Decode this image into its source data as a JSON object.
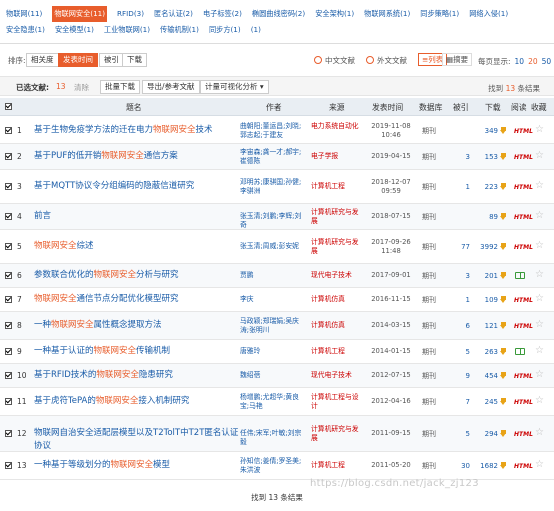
{
  "tags": [
    {
      "label": "物联网",
      "count": "(11)",
      "active": false
    },
    {
      "label": "物联网安全",
      "count": "(11)",
      "active": true
    },
    {
      "label": "RFID",
      "count": "(3)",
      "active": false
    },
    {
      "label": "匿名认证",
      "count": "(2)",
      "active": false
    },
    {
      "label": "电子标签",
      "count": "(2)",
      "active": false
    },
    {
      "label": "椭圆曲线密码",
      "count": "(2)",
      "active": false
    },
    {
      "label": "安全架构",
      "count": "(1)",
      "active": false
    },
    {
      "label": "物联网系统",
      "count": "(1)",
      "active": false
    },
    {
      "label": "同步策略",
      "count": "(1)",
      "active": false
    },
    {
      "label": "网络入侵",
      "count": "(1)",
      "active": false
    },
    {
      "label": "安全隐患",
      "count": "(1)",
      "active": false
    },
    {
      "label": "安全模型",
      "count": "(1)",
      "active": false
    },
    {
      "label": "工业物联网",
      "count": "(1)",
      "active": false
    },
    {
      "label": "传输机制",
      "count": "(1)",
      "active": false
    },
    {
      "label": "同步方",
      "count": "(1)",
      "active": false
    },
    {
      "label": "",
      "count": "(1)",
      "active": false
    }
  ],
  "sort": {
    "label": "排序:",
    "options": [
      "相关度",
      "发表时间",
      "被引",
      "下载"
    ],
    "active_index": 1
  },
  "lang": {
    "chinese": "中文文献",
    "foreign": "外文文献"
  },
  "view": {
    "list": "列表",
    "abstract": "摘要"
  },
  "perpage": {
    "label": "每页显示:",
    "options": [
      "10",
      "20",
      "50"
    ],
    "selected": "20"
  },
  "selection": {
    "label": "已选文献:",
    "count": "13",
    "clear": "清除",
    "buttons": [
      "批量下载",
      "导出/参考文献",
      "计量可视化分析 ▾"
    ]
  },
  "found_top": {
    "prefix": "找到",
    "count": "13",
    "suffix": "条结果"
  },
  "columns": {
    "title": "题名",
    "author": "作者",
    "source": "来源",
    "date": "发表时间",
    "db": "数据库",
    "cite": "被引",
    "download": "下载",
    "read": "阅读",
    "fav": "收藏"
  },
  "rows": [
    {
      "num": "1",
      "title": [
        "基于生物免疫学方法的迁在电力",
        "物联网安全",
        "技术"
      ],
      "author": "曲朝阳;董运昌;刘晓;郭志起;于建友",
      "source": "电力系统自动化",
      "date": "2019-11-08 10:46",
      "db": "期刊",
      "cite": "",
      "download": "349",
      "read": "html"
    },
    {
      "num": "2",
      "title": [
        "基于PUF的低开销",
        "物联网安全",
        "通信方案"
      ],
      "author": "李宙森;龚一才;郝宇;崔德陈",
      "source": "电子学报",
      "date": "2019-04-15",
      "db": "期刊",
      "cite": "3",
      "download": "153",
      "read": "html"
    },
    {
      "num": "3",
      "title": [
        "基于MQTT协议令分组编码的隐蔽信道研究",
        "",
        " "
      ],
      "author": "邓明苏;康骐国;孙健;李骐洲",
      "source": "计算机工程",
      "date": "2018-12-07 09:59",
      "db": "期刊",
      "cite": "1",
      "download": "223",
      "read": "html"
    },
    {
      "num": "4",
      "title": [
        "前言",
        "",
        ""
      ],
      "author": "张玉清;刘鹏;李辉;刘奇",
      "source": "计算机研究与发展",
      "date": "2018-07-15",
      "db": "期刊",
      "cite": "",
      "download": "89",
      "read": "html"
    },
    {
      "num": "5",
      "title": [
        "",
        "物联网安全",
        "综述"
      ],
      "author": "张玉清;周威;彭安妮",
      "source": "计算机研究与发展",
      "date": "2017-09-26 11:48",
      "db": "期刊",
      "cite": "77",
      "download": "3992",
      "read": "html"
    },
    {
      "num": "6",
      "title": [
        "参数联合优化的",
        "物联网安全",
        "分析与研究"
      ],
      "author": "贾鹏",
      "source": "现代电子技术",
      "date": "2017-09-01",
      "db": "期刊",
      "cite": "3",
      "download": "201",
      "read": "book"
    },
    {
      "num": "7",
      "title": [
        "",
        "物联网安全",
        "通信节点分配优化模型研究"
      ],
      "author": "李庆",
      "source": "计算机仿真",
      "date": "2016-11-15",
      "db": "期刊",
      "cite": "1",
      "download": "109",
      "read": "html"
    },
    {
      "num": "8",
      "title": [
        "一种",
        "物联网安全",
        "属性概念提取方法"
      ],
      "author": "马政颖;郑瑞娟;吴庆涛;张明川",
      "source": "计算机仿真",
      "date": "2014-03-15",
      "db": "期刊",
      "cite": "6",
      "download": "121",
      "read": "html"
    },
    {
      "num": "9",
      "title": [
        "一种基于认证的",
        "物联网安全",
        "传输机制"
      ],
      "author": "唐雅玲",
      "source": "计算机工程",
      "date": "2014-01-15",
      "db": "期刊",
      "cite": "5",
      "download": "263",
      "read": "book"
    },
    {
      "num": "10",
      "title": [
        "基于RFID技术的",
        "物联网安全",
        "隐患研究"
      ],
      "author": "魏绍蓓",
      "source": "现代电子技术",
      "date": "2012-07-15",
      "db": "期刊",
      "cite": "9",
      "download": "454",
      "read": "html"
    },
    {
      "num": "11",
      "title": [
        "基于虎符TePA的",
        "物联网安全",
        "接入机制研究"
      ],
      "author": "杨增鹏;尤超华;黄良宝;马艳",
      "source": "计算机工程与设计",
      "date": "2012-04-16",
      "db": "期刊",
      "cite": "7",
      "download": "245",
      "read": "html"
    },
    {
      "num": "12",
      "title": [
        "物联网自治安全适配层模型以及T2TolT中T2T匿名认证协议",
        "",
        ""
      ],
      "author": "任伟;宋军;叶敏;刘宗毅",
      "source": "计算机研究与发展",
      "date": "2011-09-15",
      "db": "期刊",
      "cite": "5",
      "download": "294",
      "read": "html"
    },
    {
      "num": "13",
      "title": [
        "一种基于等级划分的",
        "物联网安全",
        "模型"
      ],
      "author": "孙知信;姜倩;罗圣美;朱洪波",
      "source": "计算机工程",
      "date": "2011-05-20",
      "db": "期刊",
      "cite": "30",
      "download": "1682",
      "read": "html"
    }
  ],
  "footer": {
    "prefix": "找到",
    "count": "13",
    "suffix": "条结果"
  },
  "watermark": "https://blog.csdn.net/jack_zj123",
  "colors": {
    "accent": "#e85d2c",
    "link": "#1a5ca8",
    "source": "#cc0000",
    "header_bg": "#e9eef3"
  }
}
